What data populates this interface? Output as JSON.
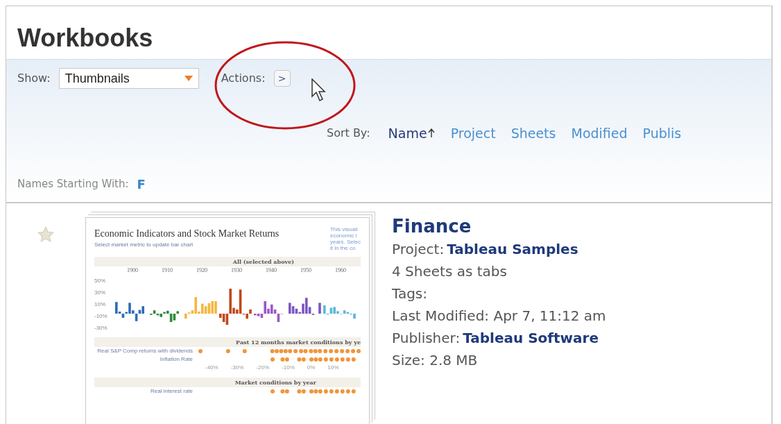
{
  "page_title": "Workbooks",
  "toolbar": {
    "show_label": "Show:",
    "show_value": "Thumbnails",
    "actions_label": "Actions:",
    "actions_button": ">"
  },
  "sort": {
    "label": "Sort By:",
    "options": [
      {
        "label": "Name",
        "selected": true
      },
      {
        "label": "Project",
        "selected": false
      },
      {
        "label": "Sheets",
        "selected": false
      },
      {
        "label": "Modified",
        "selected": false
      },
      {
        "label": "Publis",
        "selected": false
      }
    ]
  },
  "filter": {
    "label": "Names Starting With:",
    "letter": "F"
  },
  "workbooks": [
    {
      "starred": false,
      "name": "Finance",
      "thumbnail": {
        "title": "Economic Indicators and Stock Market Returns",
        "subtitle": "Select market metric to update bar chart",
        "side_text": [
          "This visuali",
          "economic i",
          "years. Selec",
          "it in the co"
        ],
        "section_1": "All (selected above)",
        "years": [
          "1900",
          "1910",
          "1920",
          "1930",
          "1940",
          "1950",
          "1960"
        ],
        "yticks": [
          "50%",
          "30%",
          "10%",
          "-10%",
          "-30%"
        ],
        "section_2": "Past 12 months market conditions by ye",
        "rows_2": [
          "Real S&P Comp returns with dividends",
          "Inflation Rate"
        ],
        "xticks": [
          "-40%",
          "-30%",
          "-20%",
          "-10%",
          "0%",
          "10%"
        ],
        "section_3": "Market conditions by year",
        "rows_3": [
          "Real interest rate"
        ]
      },
      "details": [
        {
          "label": "Project:",
          "value": "Tableau Samples"
        },
        {
          "label": "4 Sheets as tabs"
        },
        {
          "label": "Tags:"
        },
        {
          "label": "Last Modified: Apr 7, 11:12 am"
        },
        {
          "label": "Publisher:",
          "value": "Tableau Software"
        },
        {
          "label": "Size: 2.8 MB"
        }
      ]
    }
  ]
}
